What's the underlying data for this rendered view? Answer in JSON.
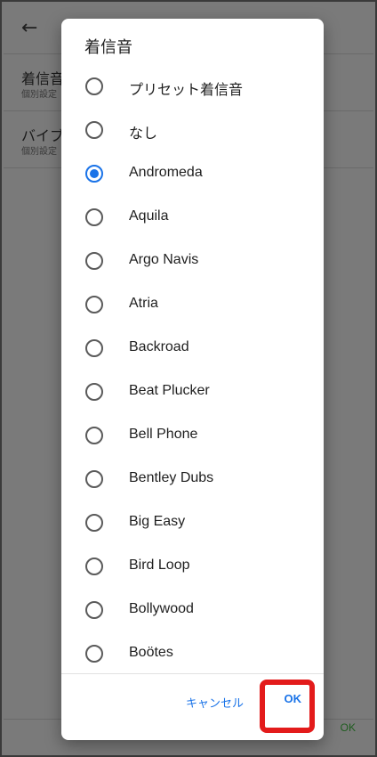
{
  "background": {
    "back_icon": "arrow-left-icon",
    "rows": [
      {
        "title": "着信音",
        "subtitle": "個別設定"
      },
      {
        "title": "バイブ",
        "subtitle": "個別設定"
      }
    ],
    "footer_ok": "OK"
  },
  "dialog": {
    "title": "着信音",
    "options": [
      {
        "label": "プリセット着信音",
        "selected": false
      },
      {
        "label": "なし",
        "selected": false
      },
      {
        "label": "Andromeda",
        "selected": true
      },
      {
        "label": "Aquila",
        "selected": false
      },
      {
        "label": "Argo Navis",
        "selected": false
      },
      {
        "label": "Atria",
        "selected": false
      },
      {
        "label": "Backroad",
        "selected": false
      },
      {
        "label": "Beat Plucker",
        "selected": false
      },
      {
        "label": "Bell Phone",
        "selected": false
      },
      {
        "label": "Bentley Dubs",
        "selected": false
      },
      {
        "label": "Big Easy",
        "selected": false
      },
      {
        "label": "Bird Loop",
        "selected": false
      },
      {
        "label": "Bollywood",
        "selected": false
      },
      {
        "label": "Boötes",
        "selected": false
      }
    ],
    "cancel_label": "キャンセル",
    "ok_label": "OK"
  },
  "colors": {
    "accent": "#1a73e8",
    "highlight": "#e31b1b",
    "scrim": "#7a7a7a"
  }
}
